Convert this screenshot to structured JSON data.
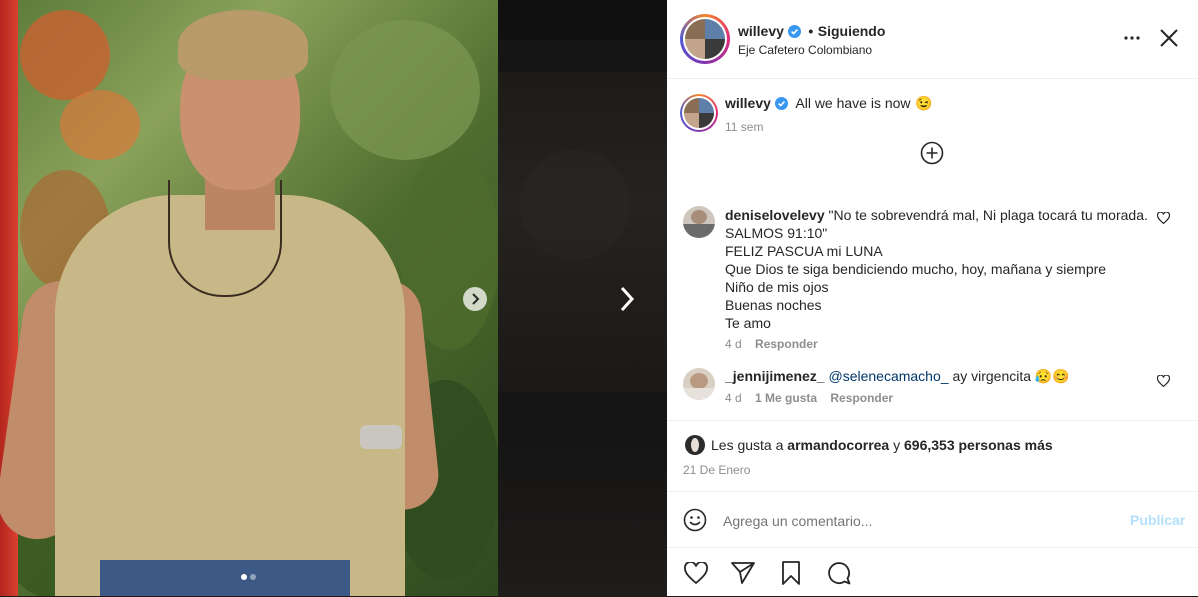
{
  "post": {
    "username": "willevy",
    "separator": "•",
    "follow_status": "Siguiendo",
    "location": "Eje Cafetero Colombiano",
    "caption_text": "All we have is now",
    "caption_emoji": "😉",
    "caption_age": "11 sem",
    "more_icon": "more-horizontal-icon",
    "close_icon": "close-icon"
  },
  "comments": [
    {
      "username": "deniselovelevy",
      "lines": [
        "\"No te sobrevendrá mal, Ni plaga tocará tu morada.",
        "SALMOS 91:10\"",
        "FELIZ PASCUA mi LUNA",
        "Que Dios te siga bendiciendo mucho, hoy, mañana y siempre",
        "Niño de mis ojos",
        "Buenas noches",
        "Te amo"
      ],
      "age": "4 d",
      "reply_label": "Responder"
    },
    {
      "username": "_jennijimenez_",
      "mention": "@selenecamacho_",
      "text": "ay virgencita",
      "emojis": "😥😊",
      "age": "4 d",
      "likes_label": "1 Me gusta",
      "reply_label": "Responder"
    }
  ],
  "likes": {
    "prefix": "Les gusta a",
    "user": "armandocorrea",
    "conjunction": "y",
    "count": "696,353 personas más",
    "date": "21 De Enero"
  },
  "add_comment": {
    "placeholder": "Agrega un comentario...",
    "publish_label": "Publicar"
  },
  "carousel": {
    "current_index": 1,
    "total": 2
  },
  "colors": {
    "verified_blue": "#3897f0",
    "link_blue": "#00376b",
    "publish_disabled": "#b2dffc",
    "muted": "#8e8e8e"
  }
}
